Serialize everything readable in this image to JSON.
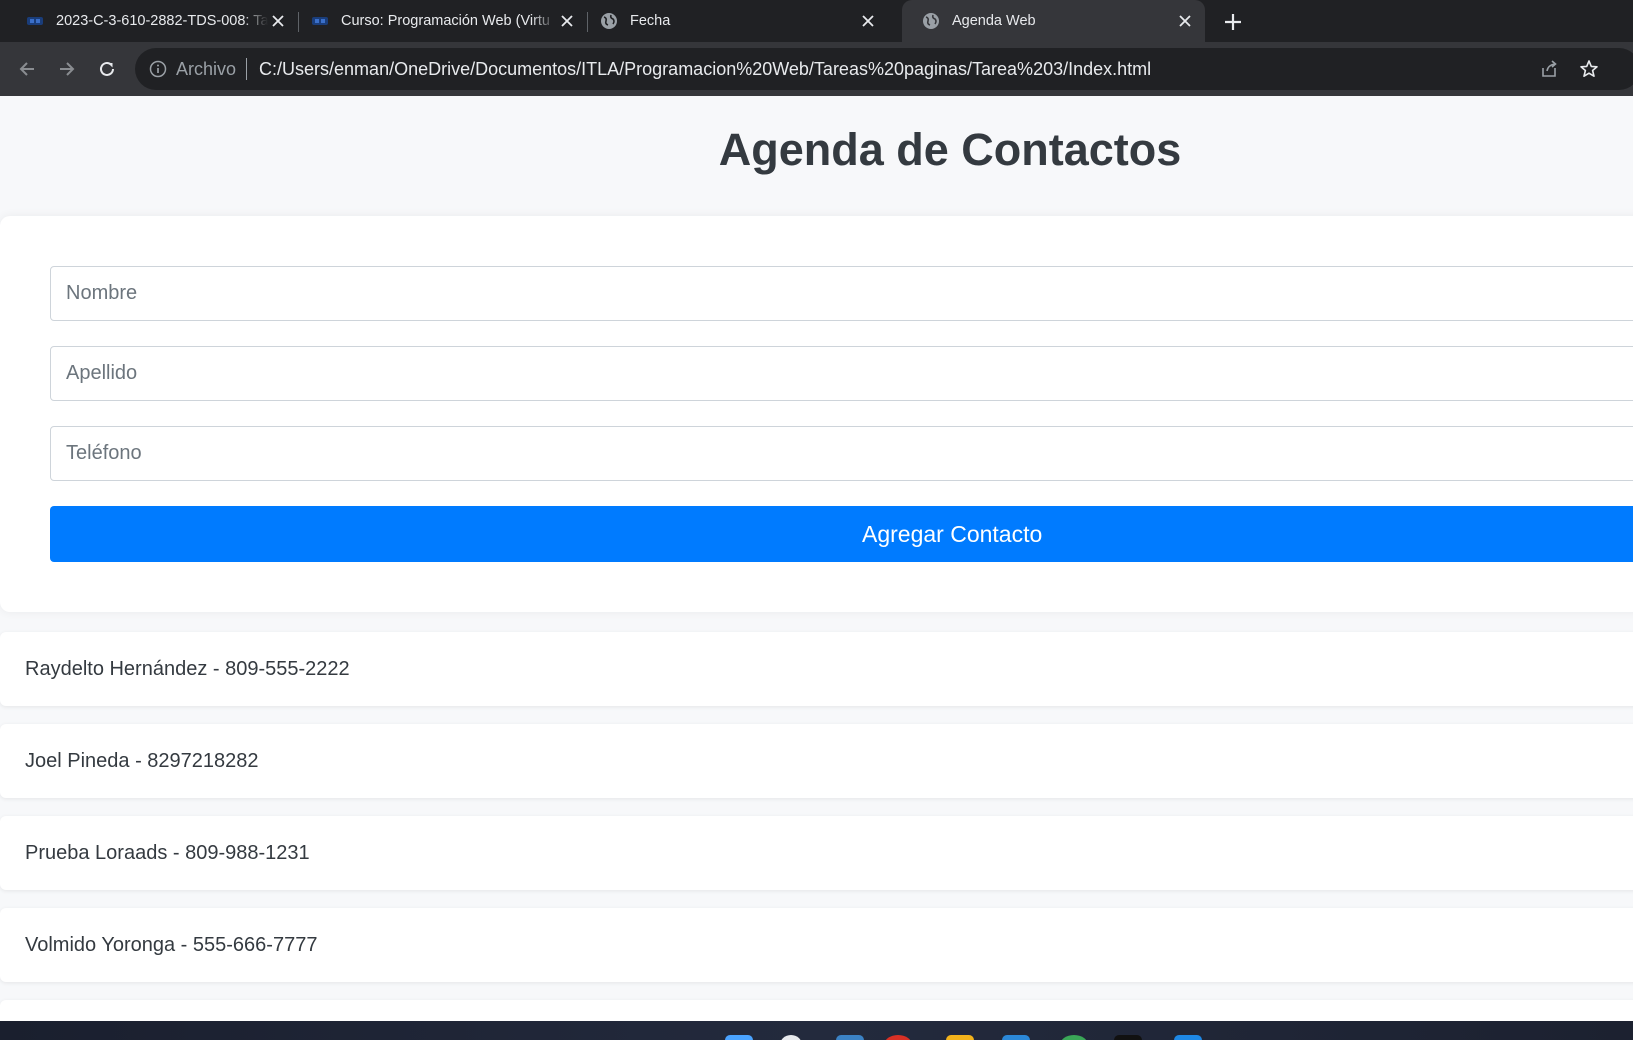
{
  "browser": {
    "tabs": [
      {
        "title": "2023-C-3-610-2882-TDS-008: Ta",
        "favicon": "site-logo-icon",
        "active": false
      },
      {
        "title": "Curso: Programación Web (Virtu",
        "favicon": "site-logo-icon",
        "active": false
      },
      {
        "title": "Fecha",
        "favicon": "globe-icon",
        "active": false
      },
      {
        "title": "Agenda Web",
        "favicon": "globe-icon",
        "active": true
      }
    ],
    "address": {
      "scheme_label": "Archivo",
      "url": "C:/Users/enman/OneDrive/Documentos/ITLA/Programacion%20Web/Tareas%20paginas/Tarea%203/Index.html"
    }
  },
  "page": {
    "title": "Agenda de Contactos",
    "form": {
      "nombre_placeholder": "Nombre",
      "apellido_placeholder": "Apellido",
      "telefono_placeholder": "Teléfono",
      "submit_label": "Agregar Contacto"
    },
    "contacts": [
      {
        "text": "Raydelto Hernández - 809-555-2222"
      },
      {
        "text": "Joel Pineda - 8297218282"
      },
      {
        "text": "Prueba Loraads - 809-988-1231"
      },
      {
        "text": "Volmido Yoronga - 555-666-7777"
      }
    ]
  },
  "colors": {
    "accent": "#007bff",
    "page_background": "#f7f8fa",
    "heading": "#343a40",
    "browser_chrome": "#202124",
    "active_tab": "#35363a"
  }
}
